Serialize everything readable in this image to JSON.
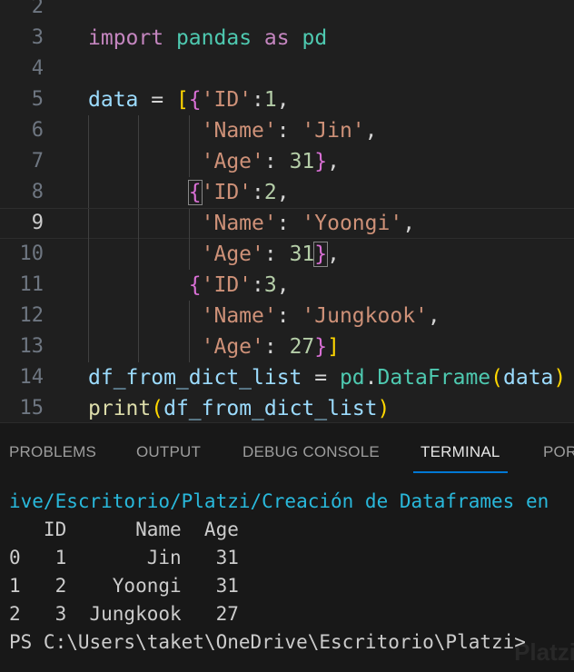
{
  "editor": {
    "current_line": 9,
    "lines": [
      {
        "n": "2",
        "tokens": []
      },
      {
        "n": "3",
        "tokens": [
          [
            "import",
            "kw"
          ],
          [
            " ",
            "pl"
          ],
          [
            "pandas",
            "mod"
          ],
          [
            " ",
            "pl"
          ],
          [
            "as",
            "kw"
          ],
          [
            " ",
            "pl"
          ],
          [
            "pd",
            "mod"
          ]
        ]
      },
      {
        "n": "4",
        "tokens": []
      },
      {
        "n": "5",
        "tokens": [
          [
            "data",
            "var"
          ],
          [
            " = ",
            "pl"
          ],
          [
            "[",
            "b1"
          ],
          [
            "{",
            "b2"
          ],
          [
            "'ID'",
            "str"
          ],
          [
            ":",
            "pl"
          ],
          [
            "1",
            "num"
          ],
          [
            ",",
            "pl"
          ]
        ]
      },
      {
        "n": "6",
        "guides": 3,
        "tokens": [
          [
            "         ",
            "pl"
          ],
          [
            "'Name'",
            "str"
          ],
          [
            ": ",
            "pl"
          ],
          [
            "'Jin'",
            "str"
          ],
          [
            ",",
            "pl"
          ]
        ]
      },
      {
        "n": "7",
        "guides": 3,
        "tokens": [
          [
            "         ",
            "pl"
          ],
          [
            "'Age'",
            "str"
          ],
          [
            ": ",
            "pl"
          ],
          [
            "31",
            "num"
          ],
          [
            "}",
            "b2"
          ],
          [
            ",",
            "pl"
          ]
        ]
      },
      {
        "n": "8",
        "guides": 2,
        "tokens": [
          [
            "        ",
            "pl"
          ],
          [
            "{",
            "b2 bm"
          ],
          [
            "'ID'",
            "str"
          ],
          [
            ":",
            "pl"
          ],
          [
            "2",
            "num"
          ],
          [
            ",",
            "pl"
          ]
        ]
      },
      {
        "n": "9",
        "guides": 3,
        "tokens": [
          [
            "         ",
            "pl"
          ],
          [
            "'Name'",
            "str"
          ],
          [
            ": ",
            "pl"
          ],
          [
            "'Yoongi'",
            "str"
          ],
          [
            ",",
            "pl"
          ]
        ]
      },
      {
        "n": "10",
        "guides": 3,
        "tokens": [
          [
            "         ",
            "pl"
          ],
          [
            "'Age'",
            "str"
          ],
          [
            ": ",
            "pl"
          ],
          [
            "31",
            "num"
          ],
          [
            "}",
            "b2 bm"
          ],
          [
            ",",
            "pl"
          ]
        ]
      },
      {
        "n": "11",
        "guides": 2,
        "tokens": [
          [
            "        ",
            "pl"
          ],
          [
            "{",
            "b2"
          ],
          [
            "'ID'",
            "str"
          ],
          [
            ":",
            "pl"
          ],
          [
            "3",
            "num"
          ],
          [
            ",",
            "pl"
          ]
        ]
      },
      {
        "n": "12",
        "guides": 3,
        "tokens": [
          [
            "         ",
            "pl"
          ],
          [
            "'Name'",
            "str"
          ],
          [
            ": ",
            "pl"
          ],
          [
            "'Jungkook'",
            "str"
          ],
          [
            ",",
            "pl"
          ]
        ]
      },
      {
        "n": "13",
        "guides": 3,
        "tokens": [
          [
            "         ",
            "pl"
          ],
          [
            "'Age'",
            "str"
          ],
          [
            ": ",
            "pl"
          ],
          [
            "27",
            "num"
          ],
          [
            "}",
            "b2"
          ],
          [
            "]",
            "b1"
          ]
        ]
      },
      {
        "n": "14",
        "tokens": [
          [
            "df_from_dict_list",
            "var"
          ],
          [
            " = ",
            "pl"
          ],
          [
            "pd",
            "mod"
          ],
          [
            ".",
            "pl"
          ],
          [
            "DataFrame",
            "mod"
          ],
          [
            "(",
            "b1"
          ],
          [
            "data",
            "var"
          ],
          [
            ")",
            "b1"
          ]
        ]
      },
      {
        "n": "15",
        "tokens": [
          [
            "print",
            "fn"
          ],
          [
            "(",
            "b1"
          ],
          [
            "df_from_dict_list",
            "var"
          ],
          [
            ")",
            "b1"
          ]
        ]
      }
    ]
  },
  "panel": {
    "tabs": [
      {
        "label": "PROBLEMS",
        "active": false
      },
      {
        "label": "OUTPUT",
        "active": false
      },
      {
        "label": "DEBUG CONSOLE",
        "active": false
      },
      {
        "label": "TERMINAL",
        "active": true
      },
      {
        "label": "POR",
        "active": false
      }
    ],
    "terminal": {
      "path_line": "ive/Escritorio/Platzi/Creación de Dataframes en",
      "output": [
        "   ID      Name  Age",
        "0   1       Jin   31",
        "1   2    Yoongi   31",
        "2   3  Jungkook   27"
      ],
      "prompt": "PS C:\\Users\\taket\\OneDrive\\Escritorio\\Platzi>"
    }
  },
  "watermark": "Platzi"
}
